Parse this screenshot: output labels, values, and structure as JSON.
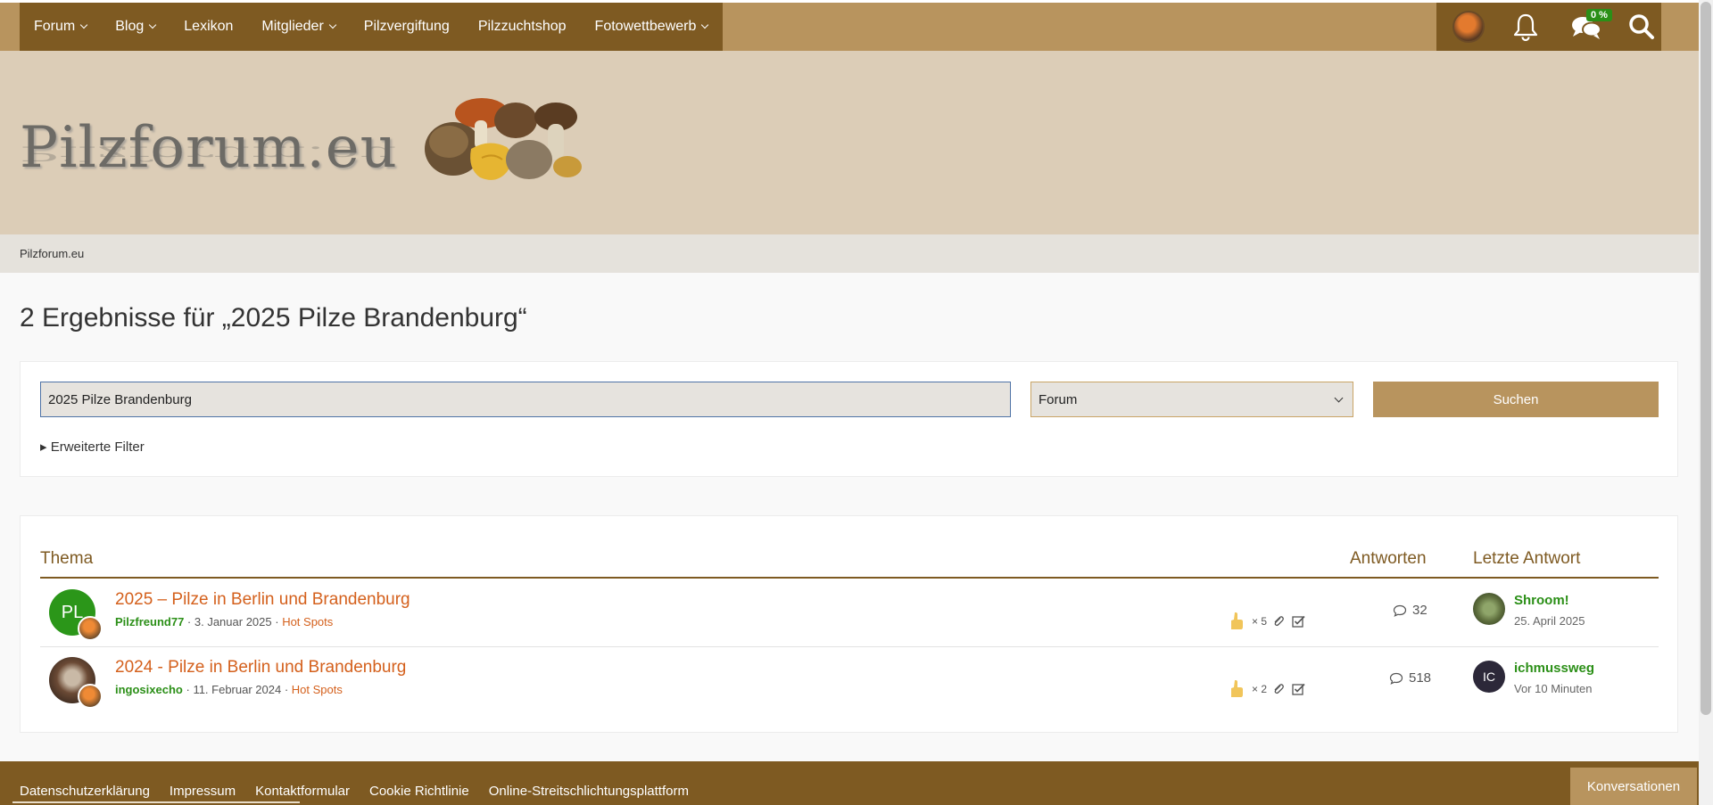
{
  "nav": {
    "items": [
      {
        "label": "Forum",
        "has_dropdown": true
      },
      {
        "label": "Blog",
        "has_dropdown": true
      },
      {
        "label": "Lexikon",
        "has_dropdown": false
      },
      {
        "label": "Mitglieder",
        "has_dropdown": true
      },
      {
        "label": "Pilzvergiftung",
        "has_dropdown": false
      },
      {
        "label": "Pilzzuchtshop",
        "has_dropdown": false
      },
      {
        "label": "Fotowettbewerb",
        "has_dropdown": true
      }
    ],
    "icons": [
      "user-avatar",
      "bell-icon",
      "conversations-icon",
      "search-icon"
    ],
    "conversations_badge": "0 %"
  },
  "header": {
    "logo_text": "Pilzforum.eu"
  },
  "breadcrumb": {
    "home": "Pilzforum.eu"
  },
  "page": {
    "title": "2 Ergebnisse für „2025 Pilze Brandenburg“"
  },
  "search": {
    "query": "2025 Pilze Brandenburg",
    "scope_selected": "Forum",
    "submit_label": "Suchen",
    "advanced_filters_label": "▸ Erweiterte Filter"
  },
  "results": {
    "headers": {
      "topic": "Thema",
      "replies": "Antworten",
      "last_reply": "Letzte Antwort"
    },
    "rows": [
      {
        "avatar_initials": "PL",
        "title": "2025 – Pilze in Berlin und Brandenburg",
        "author": "Pilzfreund77",
        "date": "3. Januar 2025",
        "forum": "Hot Spots",
        "likes": "× 5",
        "replies": "32",
        "last_author": "Shroom!",
        "last_date": "25. April 2025",
        "last_avatar_initials": ""
      },
      {
        "avatar_initials": "",
        "title": "2024 - Pilze in Berlin und Brandenburg",
        "author": "ingosixecho",
        "date": "11. Februar 2024",
        "forum": "Hot Spots",
        "likes": "× 2",
        "replies": "518",
        "last_author": "ichmussweg",
        "last_date": "Vor 10 Minuten",
        "last_avatar_initials": "IC"
      }
    ]
  },
  "footer": {
    "links": [
      "Datenschutzerklärung",
      "Impressum",
      "Kontaktformular",
      "Cookie Richtlinie",
      "Online-Streitschlichtungsplattform"
    ],
    "conversations_button": "Konversationen"
  },
  "colors": {
    "nav_dark": "#7e5a22",
    "nav_light": "#b8945e",
    "header_bg": "#dccdb7",
    "title_link": "#d4601c",
    "user_link": "#2b8f17"
  }
}
